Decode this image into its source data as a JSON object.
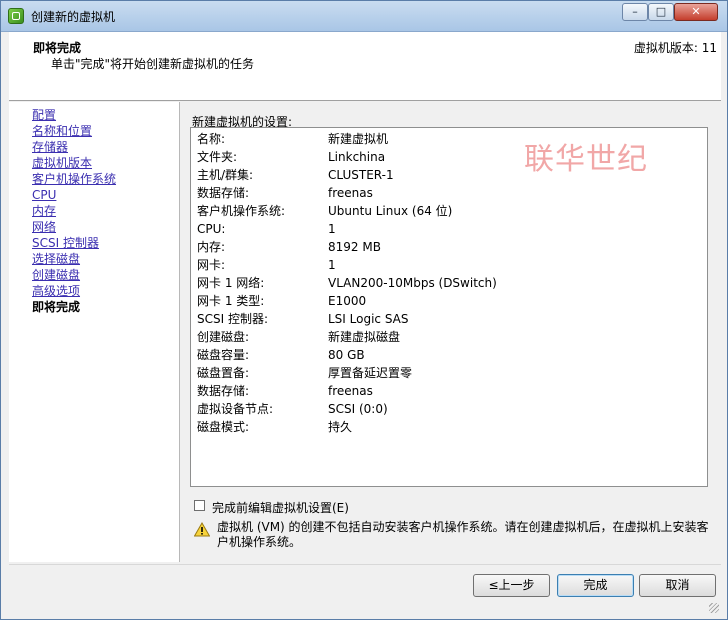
{
  "window": {
    "title": "创建新的虚拟机",
    "controls": {
      "minimize": "–",
      "maximize": "□",
      "close": "✕"
    }
  },
  "header": {
    "title": "即将完成",
    "subtitle": "单击\"完成\"将开始创建新虚拟机的任务",
    "version": "虚拟机版本: 11"
  },
  "nav": {
    "items": [
      {
        "label": "配置",
        "current": false
      },
      {
        "label": "名称和位置",
        "current": false
      },
      {
        "label": "存储器",
        "current": false
      },
      {
        "label": "虚拟机版本",
        "current": false
      },
      {
        "label": "客户机操作系统",
        "current": false
      },
      {
        "label": "CPU",
        "current": false
      },
      {
        "label": "内存",
        "current": false
      },
      {
        "label": "网络",
        "current": false
      },
      {
        "label": "SCSI 控制器",
        "current": false
      },
      {
        "label": "选择磁盘",
        "current": false
      },
      {
        "label": "创建磁盘",
        "current": false
      },
      {
        "label": "高级选项",
        "current": false
      },
      {
        "label": "即将完成",
        "current": true
      }
    ]
  },
  "settings": {
    "heading": "新建虚拟机的设置:",
    "watermark": "联华世纪",
    "rows": [
      {
        "key": "名称:",
        "value": "新建虚拟机"
      },
      {
        "key": "文件夹:",
        "value": "Linkchina"
      },
      {
        "key": "主机/群集:",
        "value": "CLUSTER-1"
      },
      {
        "key": "数据存储:",
        "value": "freenas"
      },
      {
        "key": "客户机操作系统:",
        "value": "Ubuntu Linux (64 位)"
      },
      {
        "key": "CPU:",
        "value": "1"
      },
      {
        "key": "内存:",
        "value": "8192 MB"
      },
      {
        "key": "网卡:",
        "value": "1"
      },
      {
        "key": "网卡 1 网络:",
        "value": "VLAN200-10Mbps (DSwitch)"
      },
      {
        "key": "网卡 1 类型:",
        "value": "E1000"
      },
      {
        "key": "SCSI 控制器:",
        "value": "LSI Logic SAS"
      },
      {
        "key": "创建磁盘:",
        "value": "新建虚拟磁盘"
      },
      {
        "key": "磁盘容量:",
        "value": "80 GB"
      },
      {
        "key": "磁盘置备:",
        "value": "厚置备延迟置零"
      },
      {
        "key": "数据存储:",
        "value": "freenas"
      },
      {
        "key": "虚拟设备节点:",
        "value": "SCSI (0:0)"
      },
      {
        "key": "磁盘模式:",
        "value": "持久"
      }
    ]
  },
  "edit_checkbox": {
    "label": "完成前编辑虚拟机设置(E)",
    "checked": false
  },
  "warning": {
    "icon": "warning-icon",
    "text": "虚拟机 (VM) 的创建不包括自动安装客户机操作系统。请在创建虚拟机后，在虚拟机上安装客户机操作系统。"
  },
  "buttons": {
    "back": "≤上一步",
    "finish": "完成",
    "cancel": "取消"
  }
}
